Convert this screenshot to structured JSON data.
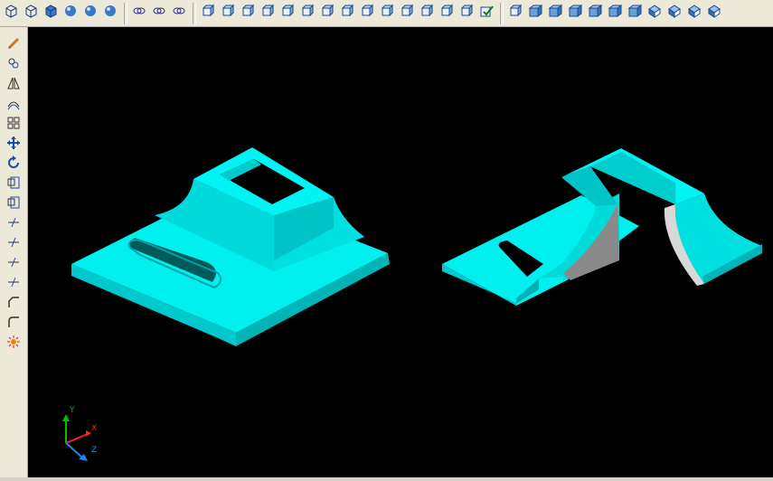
{
  "top_toolbar": {
    "groups": [
      {
        "id": "view-styles",
        "buttons": [
          "wireframe-2d-icon",
          "wireframe-3d-icon",
          "hidden-icon",
          "flat-shaded-icon",
          "gouraud-icon",
          "gouraud-edges-icon"
        ]
      },
      {
        "id": "booleans",
        "buttons": [
          "union-icon",
          "subtract-icon",
          "intersect-icon"
        ]
      },
      {
        "id": "solid-edit",
        "buttons": [
          "extrude-face-icon",
          "move-face-icon",
          "offset-face-icon",
          "delete-face-icon",
          "rotate-face-icon",
          "taper-face-icon",
          "copy-face-icon",
          "color-face-icon",
          "copy-edge-icon",
          "color-edge-icon",
          "imprint-icon",
          "clean-icon",
          "separate-icon",
          "shell-icon",
          "check-icon"
        ]
      },
      {
        "id": "views",
        "buttons": [
          "named-views-icon",
          "top-view-icon",
          "bottom-view-icon",
          "left-view-icon",
          "right-view-icon",
          "front-view-icon",
          "back-view-icon",
          "sw-iso-icon",
          "se-iso-icon",
          "ne-iso-icon",
          "nw-iso-icon"
        ]
      }
    ]
  },
  "left_toolbar": {
    "buttons": [
      "erase-icon",
      "copy-icon",
      "mirror-icon",
      "offset-icon",
      "array-icon",
      "move-icon",
      "rotate-icon",
      "scale-icon",
      "stretch-icon",
      "trim-icon",
      "extend-icon",
      "break-at-point-icon",
      "break-icon",
      "chamfer-icon",
      "fillet-icon",
      "explode-icon"
    ]
  },
  "viewport": {
    "background": "#000000",
    "solid_color": "#00e5e5",
    "cut_face_color": "#d8d8d8",
    "ucs": {
      "x_label": "X",
      "y_label": "Y",
      "z_label": "Z",
      "x_color": "#ff2020",
      "y_color": "#00c000",
      "z_color": "#2080ff"
    }
  }
}
